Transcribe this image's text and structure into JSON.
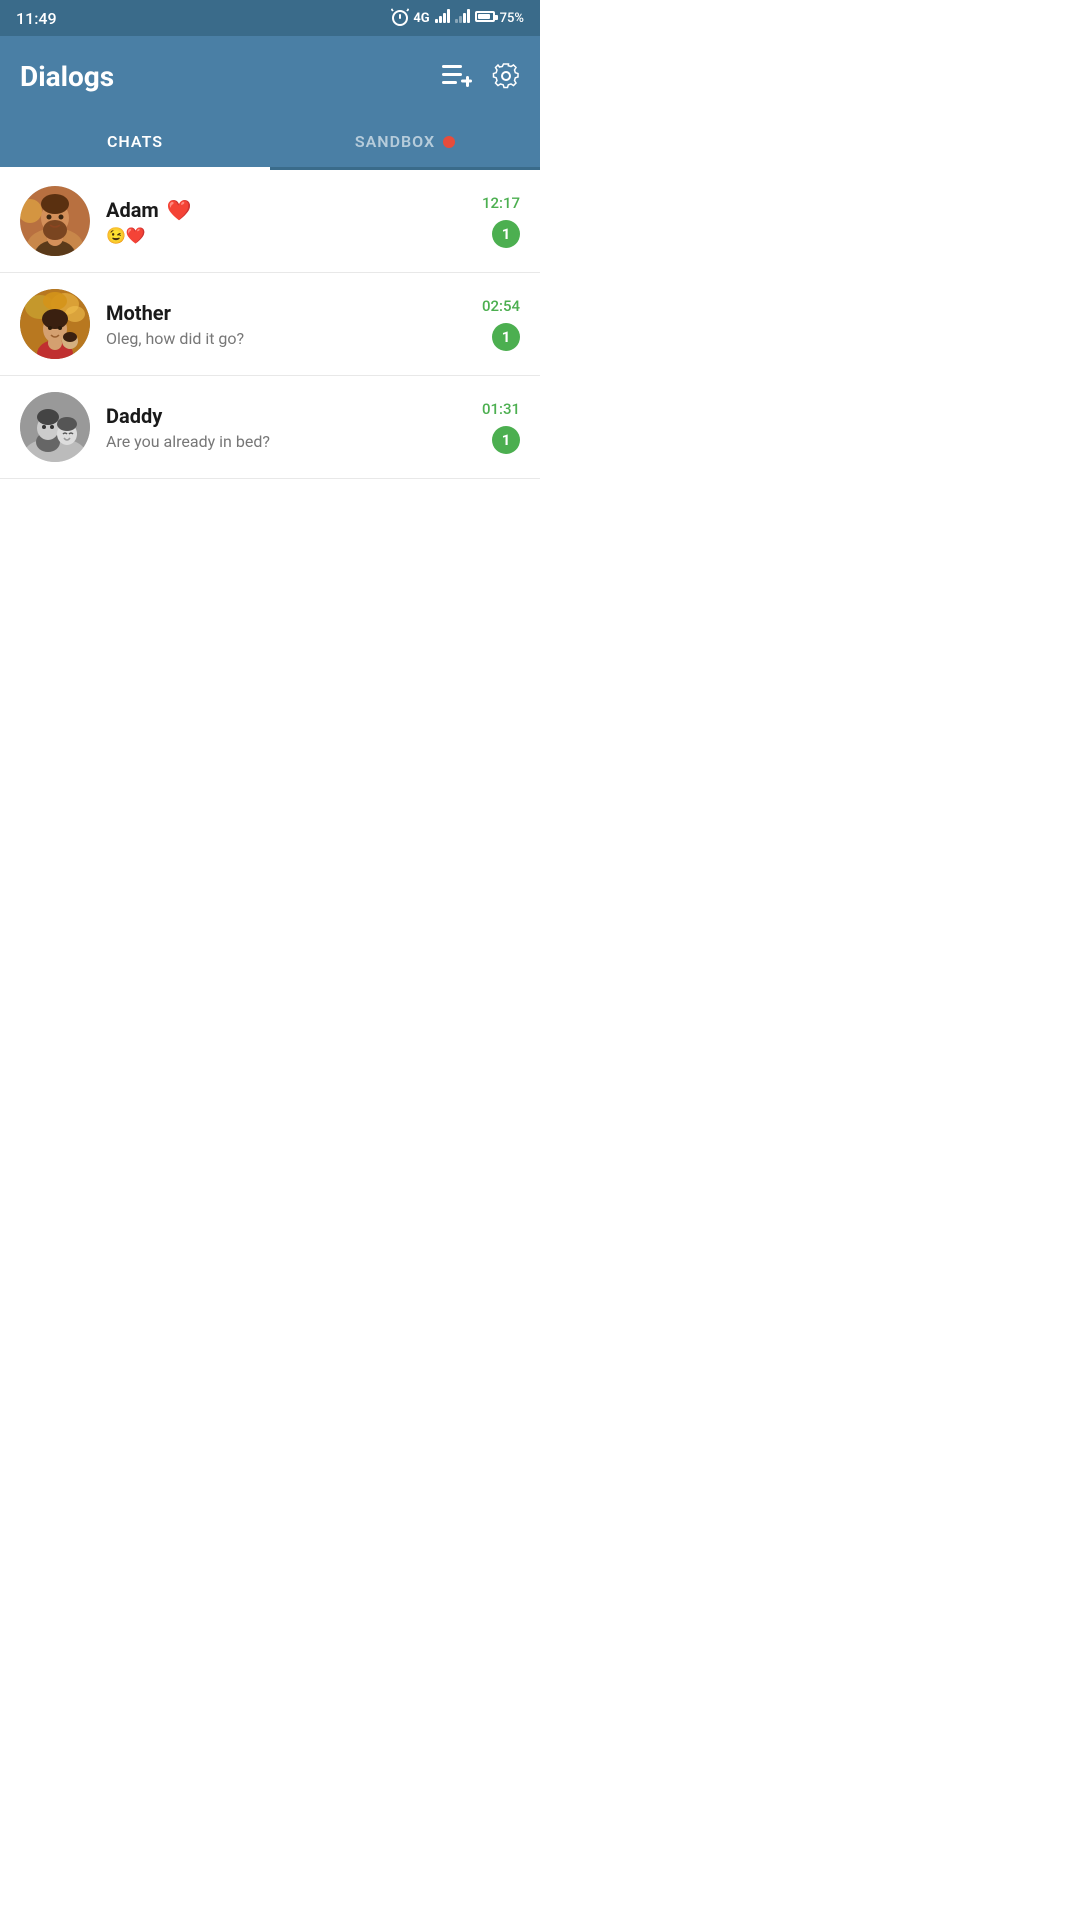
{
  "statusBar": {
    "time": "11:49",
    "network": "4G",
    "battery": "75%"
  },
  "header": {
    "title": "Dialogs",
    "newChatLabel": "New chat",
    "settingsLabel": "Settings"
  },
  "tabs": [
    {
      "id": "chats",
      "label": "CHATS",
      "active": true
    },
    {
      "id": "sandbox",
      "label": "SANDBOX",
      "active": false
    }
  ],
  "chats": [
    {
      "id": "adam",
      "name": "Adam",
      "nameEmoji": "❤️",
      "preview": "😉❤️",
      "time": "12:17",
      "unread": 1,
      "avatarType": "man-beard"
    },
    {
      "id": "mother",
      "name": "Mother",
      "preview": "Oleg, how did it go?",
      "time": "02:54",
      "unread": 1,
      "avatarType": "woman-leaves"
    },
    {
      "id": "daddy",
      "name": "Daddy",
      "preview": "Are you already in bed?",
      "time": "01:31",
      "unread": 1,
      "avatarType": "man-child-bw"
    }
  ],
  "colors": {
    "headerBg": "#4a7fa5",
    "tabActiveLine": "#ffffff",
    "unreadBadge": "#4caf50",
    "timeColor": "#4caf50",
    "sandboxDot": "#e74c3c"
  }
}
